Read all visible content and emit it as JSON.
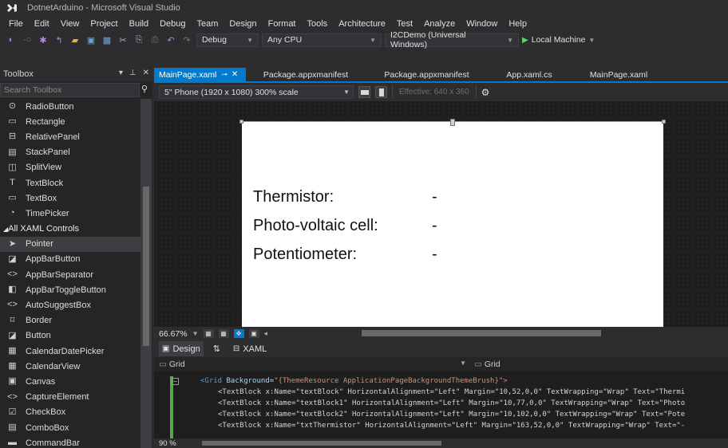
{
  "app": {
    "title": "DotnetArduino - Microsoft Visual Studio"
  },
  "menu": [
    "File",
    "Edit",
    "View",
    "Project",
    "Build",
    "Debug",
    "Team",
    "Design",
    "Format",
    "Tools",
    "Architecture",
    "Test",
    "Analyze",
    "Window",
    "Help"
  ],
  "toolbar": {
    "configuration": "Debug",
    "platform": "Any CPU",
    "startup_project": "I2CDemo (Universal Windows)",
    "run_target": "Local Machine"
  },
  "toolbox": {
    "title": "Toolbox",
    "search_placeholder": "Search Toolbox",
    "items": [
      {
        "label": "RadioButton",
        "icon": "⊙"
      },
      {
        "label": "Rectangle",
        "icon": "▭"
      },
      {
        "label": "RelativePanel",
        "icon": "⊟"
      },
      {
        "label": "StackPanel",
        "icon": "▤"
      },
      {
        "label": "SplitView",
        "icon": "◫"
      },
      {
        "label": "TextBlock",
        "icon": "T"
      },
      {
        "label": "TextBox",
        "icon": "▭"
      },
      {
        "label": "TimePicker",
        "icon": "◔"
      }
    ],
    "group_label": "All XAML Controls",
    "group_items": [
      {
        "label": "Pointer",
        "icon": "➤",
        "selected": true
      },
      {
        "label": "AppBarButton",
        "icon": "◪"
      },
      {
        "label": "AppBarSeparator",
        "icon": "<>"
      },
      {
        "label": "AppBarToggleButton",
        "icon": "◧"
      },
      {
        "label": "AutoSuggestBox",
        "icon": "<>"
      },
      {
        "label": "Border",
        "icon": "⌑"
      },
      {
        "label": "Button",
        "icon": "◪"
      },
      {
        "label": "CalendarDatePicker",
        "icon": "▦"
      },
      {
        "label": "CalendarView",
        "icon": "▦"
      },
      {
        "label": "Canvas",
        "icon": "▣"
      },
      {
        "label": "CaptureElement",
        "icon": "<>"
      },
      {
        "label": "CheckBox",
        "icon": "☑"
      },
      {
        "label": "ComboBox",
        "icon": "▤"
      },
      {
        "label": "CommandBar",
        "icon": "▬"
      }
    ]
  },
  "tabs": [
    {
      "label": "MainPage.xaml",
      "active": true
    },
    {
      "label": "Package.appxmanifest"
    },
    {
      "label": "Package.appxmanifest"
    },
    {
      "label": "App.xaml.cs"
    },
    {
      "label": "MainPage.xaml"
    }
  ],
  "designer": {
    "device": "5\" Phone (1920 x 1080) 300% scale",
    "effective": "Effective: 640 x 360"
  },
  "page": {
    "rows": [
      {
        "label": "Thermistor:",
        "value": "-"
      },
      {
        "label": "Photo-voltaic cell:",
        "value": "-"
      },
      {
        "label": "Potentiometer:",
        "value": "-"
      }
    ]
  },
  "zoom": {
    "level": "66.67%"
  },
  "viewtabs": {
    "design": "Design",
    "swap": "⇅",
    "xaml": "XAML"
  },
  "crumbs": {
    "left": "Grid",
    "right": "Grid"
  },
  "code": {
    "line1_tag": "<Grid",
    "line1_attr": "Background",
    "line1_val": "\"{ThemeResource ApplicationPageBackgroundThemeBrush}\">",
    "lines": [
      "<TextBlock x:Name=\"textBlock\" HorizontalAlignment=\"Left\" Margin=\"10,52,0,0\" TextWrapping=\"Wrap\" Text=\"Thermi",
      "<TextBlock x:Name=\"textBlock1\" HorizontalAlignment=\"Left\" Margin=\"10,77,0,0\" TextWrapping=\"Wrap\" Text=\"Photo",
      "<TextBlock x:Name=\"textBlock2\" HorizontalAlignment=\"Left\" Margin=\"10,102,0,0\" TextWrapping=\"Wrap\" Text=\"Pote",
      "<TextBlock x:Name=\"txtThermistor\" HorizontalAlignment=\"Left\" Margin=\"163,52,0,0\" TextWrapping=\"Wrap\" Text=\"-"
    ]
  },
  "status": {
    "zoom": "90 %"
  }
}
